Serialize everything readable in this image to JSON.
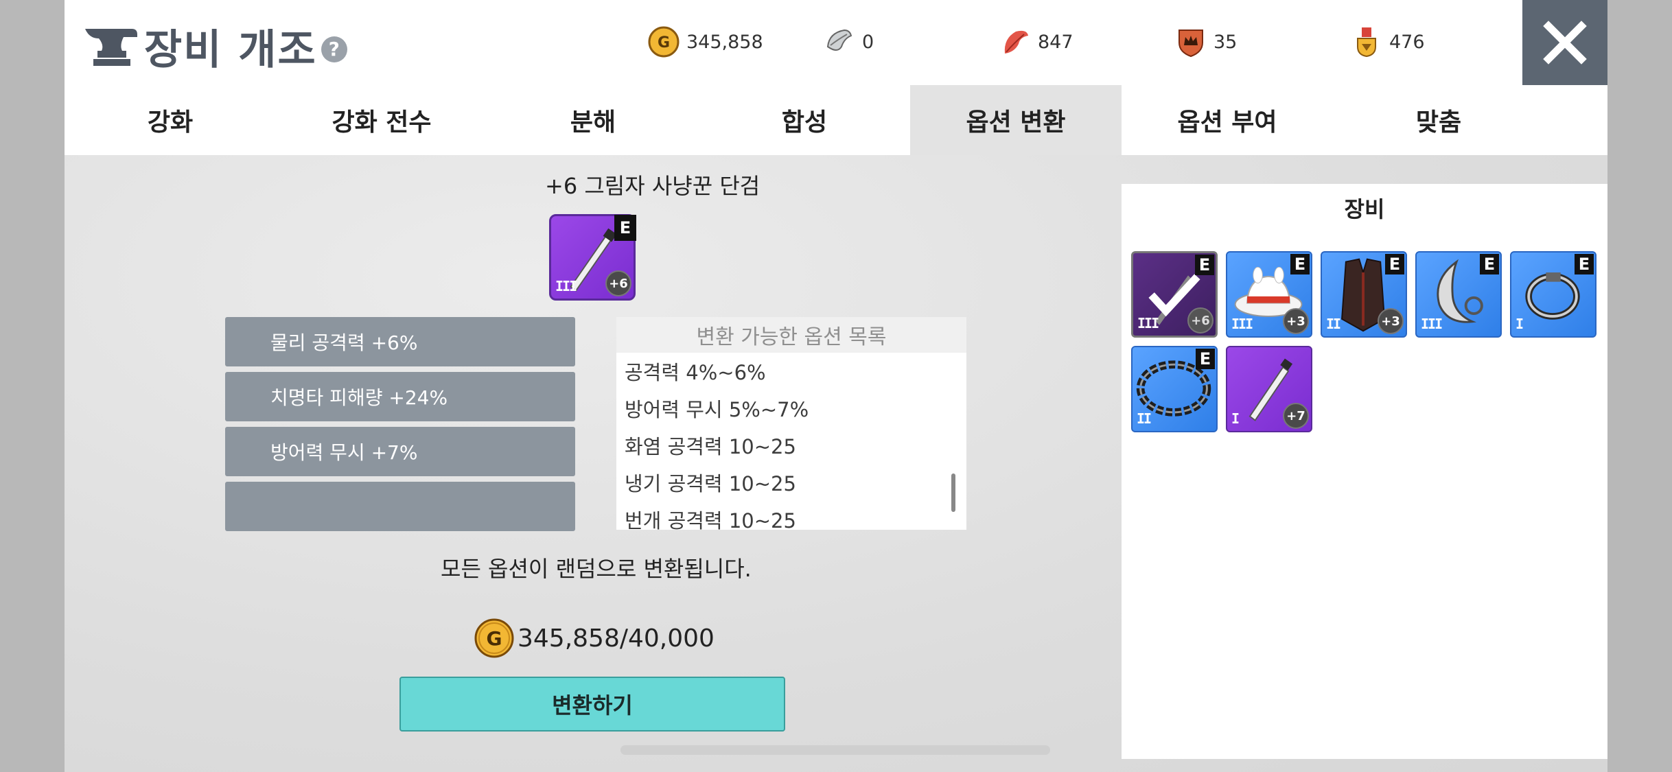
{
  "header": {
    "title": "장비 개조",
    "help": "?",
    "currencies": [
      {
        "icon": "gold-coin-icon",
        "symbol": "G",
        "value": "345,858"
      },
      {
        "icon": "silver-leaf-icon",
        "value": "0"
      },
      {
        "icon": "red-feather-icon",
        "value": "847"
      },
      {
        "icon": "crown-shield-icon",
        "value": "35"
      },
      {
        "icon": "gold-medal-icon",
        "value": "476"
      }
    ]
  },
  "tabs": [
    "강화",
    "강화 전수",
    "분해",
    "합성",
    "옵션 변환",
    "옵션 부여",
    "맞춤"
  ],
  "active_tab": "옵션 변환",
  "item": {
    "name": "+6 그림자 사냥꾼 단검",
    "badge": "E",
    "level": "+6",
    "tier": "III"
  },
  "current_options": [
    "물리 공격력 +6%",
    "치명타 피해량 +24%",
    "방어력 무시 +7%",
    ""
  ],
  "option_list": {
    "header": "변환 가능한 옵션 목록",
    "items": [
      "공격력 4%~6%",
      "방어력 무시 5%~7%",
      "화염 공격력 10~25",
      "냉기 공격력 10~25",
      "번개 공격력 10~25"
    ]
  },
  "notice": "모든 옵션이 랜덤으로 변환됩니다.",
  "cost": {
    "symbol": "G",
    "text": "345,858/40,000"
  },
  "convert_button": "변환하기",
  "equipment": {
    "title": "장비",
    "items": [
      {
        "name": "dagger",
        "badge": "E",
        "level": "+6",
        "tier": "III",
        "selected": true
      },
      {
        "name": "white-hat",
        "badge": "E",
        "level": "+3",
        "tier": "III"
      },
      {
        "name": "dark-vest",
        "badge": "E",
        "level": "+3",
        "tier": "II"
      },
      {
        "name": "crescent-earring",
        "badge": "E",
        "level": "",
        "tier": "III"
      },
      {
        "name": "silver-bracelet",
        "badge": "E",
        "level": "",
        "tier": "I"
      },
      {
        "name": "chain-necklace",
        "badge": "E",
        "level": "",
        "tier": "II"
      },
      {
        "name": "purple-dagger",
        "badge": "",
        "level": "+7",
        "tier": "I"
      }
    ]
  },
  "colors": {
    "accent_button": "#68d8d6",
    "close_bg": "#5c6672",
    "slot_bg": "#8c959e"
  }
}
